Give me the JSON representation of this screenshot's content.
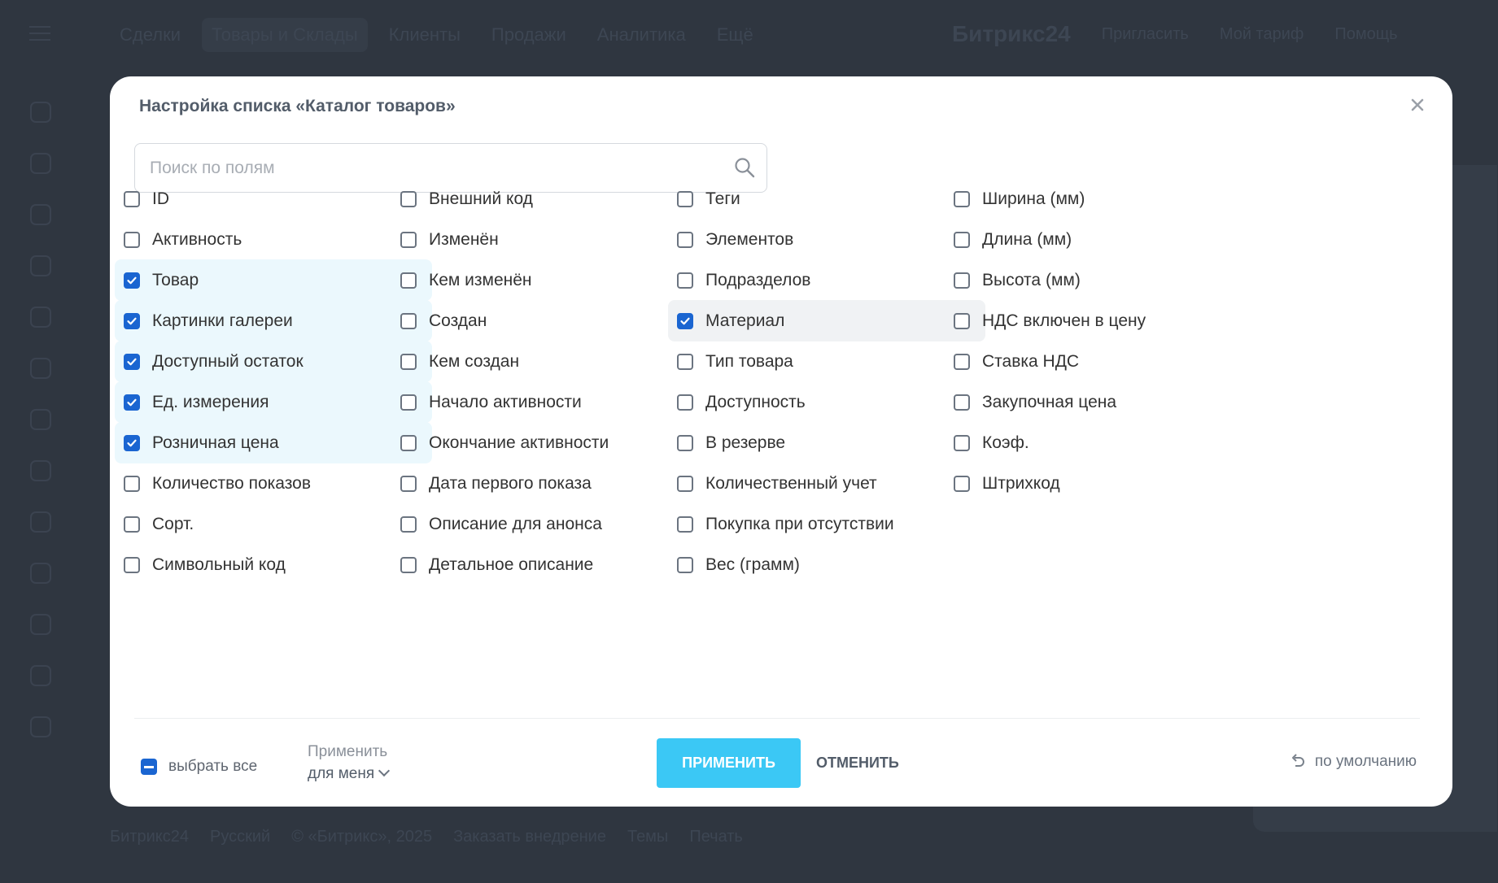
{
  "background": {
    "nav": [
      "Сделки",
      "Товары и Склады",
      "Клиенты",
      "Продажи",
      "Аналитика",
      "Ещё"
    ],
    "nav_active_index": 1,
    "nav_right": [
      "Битрикс24",
      "Пригласить",
      "Мой тариф",
      "Помощь"
    ],
    "footer": [
      "Битрикс24",
      "Русский",
      "© «Битрикс», 2025",
      "Заказать внедрение",
      "Темы",
      "Печать"
    ]
  },
  "modal": {
    "title": "Настройка списка «Каталог товаров»",
    "search_placeholder": "Поиск по полям",
    "columns": [
      [
        {
          "label": "ID",
          "checked": false
        },
        {
          "label": "Активность",
          "checked": false
        },
        {
          "label": "Товар",
          "checked": true
        },
        {
          "label": "Картинки галереи",
          "checked": true
        },
        {
          "label": "Доступный остаток",
          "checked": true
        },
        {
          "label": "Ед. измерения",
          "checked": true
        },
        {
          "label": "Розничная цена",
          "checked": true
        },
        {
          "label": "Количество показов",
          "checked": false
        },
        {
          "label": "Сорт.",
          "checked": false
        },
        {
          "label": "Символьный код",
          "checked": false
        }
      ],
      [
        {
          "label": "Внешний код",
          "checked": false
        },
        {
          "label": "Изменён",
          "checked": false
        },
        {
          "label": "Кем изменён",
          "checked": false
        },
        {
          "label": "Создан",
          "checked": false
        },
        {
          "label": "Кем создан",
          "checked": false
        },
        {
          "label": "Начало активности",
          "checked": false
        },
        {
          "label": "Окончание активности",
          "checked": false
        },
        {
          "label": "Дата первого показа",
          "checked": false
        },
        {
          "label": "Описание для анонса",
          "checked": false
        },
        {
          "label": "Детальное описание",
          "checked": false
        }
      ],
      [
        {
          "label": "Теги",
          "checked": false
        },
        {
          "label": "Элементов",
          "checked": false
        },
        {
          "label": "Подразделов",
          "checked": false
        },
        {
          "label": "Материал",
          "checked": true,
          "hover": true
        },
        {
          "label": "Тип товара",
          "checked": false
        },
        {
          "label": "Доступность",
          "checked": false
        },
        {
          "label": "В резерве",
          "checked": false
        },
        {
          "label": "Количественный учет",
          "checked": false
        },
        {
          "label": "Покупка при отсутствии",
          "checked": false
        },
        {
          "label": "Вес (грамм)",
          "checked": false
        }
      ],
      [
        {
          "label": "Ширина (мм)",
          "checked": false
        },
        {
          "label": "Длина (мм)",
          "checked": false
        },
        {
          "label": "Высота (мм)",
          "checked": false
        },
        {
          "label": "НДС включен в цену",
          "checked": false
        },
        {
          "label": "Ставка НДС",
          "checked": false
        },
        {
          "label": "Закупочная цена",
          "checked": false
        },
        {
          "label": "Коэф.",
          "checked": false
        },
        {
          "label": "Штрихкод",
          "checked": false
        }
      ]
    ],
    "select_all_label": "выбрать все",
    "apply_for_label": "Применить",
    "apply_for_value": "для меня",
    "apply_button": "ПРИМЕНИТЬ",
    "cancel_button": "ОТМЕНИТЬ",
    "reset_label": "по умолчанию",
    "icons": {
      "close": "close-icon",
      "search": "search-icon",
      "edit": "pencil-icon",
      "reset": "undo-icon"
    },
    "colors": {
      "accent": "#3bc8f5",
      "checkbox": "#1a65d1",
      "checked_bg": "#ebf8fd"
    }
  }
}
